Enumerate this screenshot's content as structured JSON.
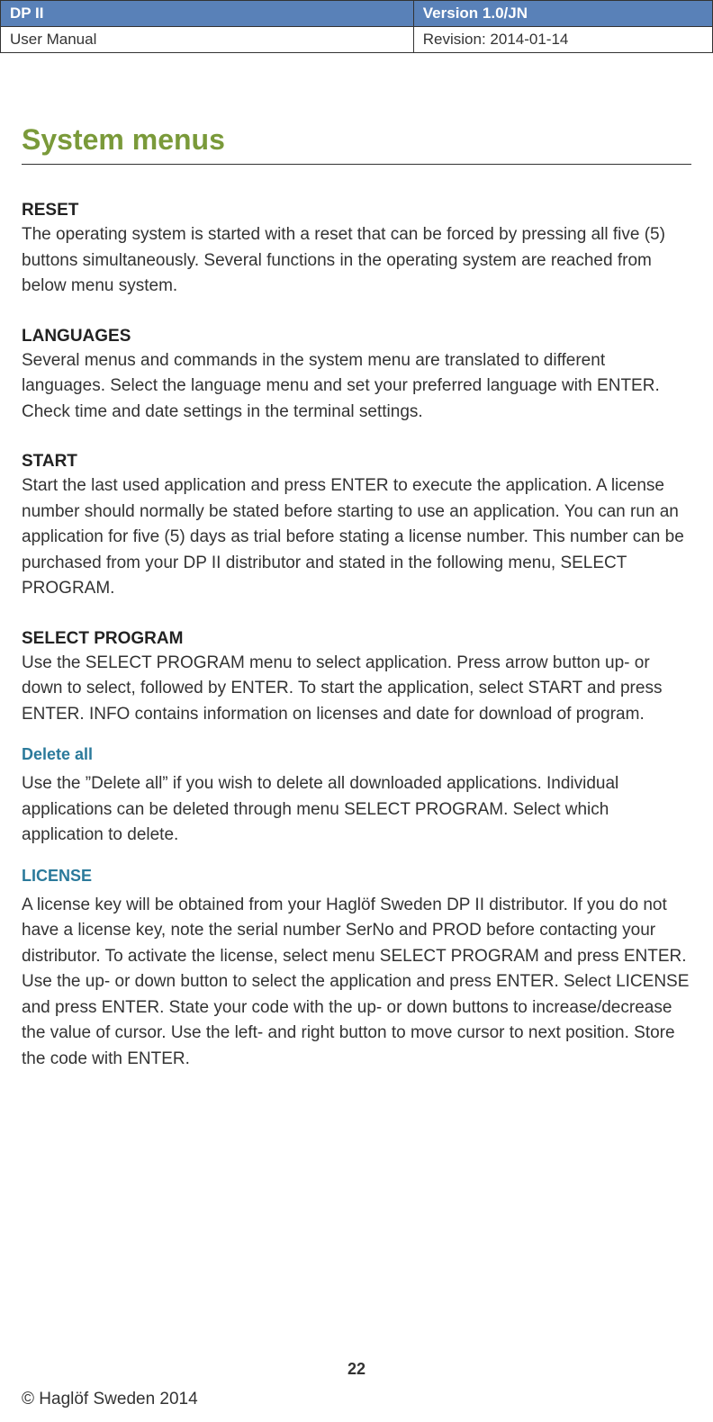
{
  "header": {
    "product": "DP II",
    "version": "Version 1.0/JN",
    "doc_type": "User Manual",
    "revision": "Revision: 2014-01-14"
  },
  "title": "System menus",
  "sections": {
    "reset": {
      "heading": "RESET",
      "text": "The operating system is started with a reset that can be forced by pressing all five (5) buttons simultaneously. Several functions in the operating system are reached from below menu system."
    },
    "languages": {
      "heading": "LANGUAGES",
      "text": "Several menus and commands in the system menu are translated to different languages. Select the language menu and set your preferred language with ENTER. Check time and date settings in the terminal settings."
    },
    "start": {
      "heading": "START",
      "text": "Start the last used application and press ENTER to execute the application. A license number should normally be stated before starting to use an application. You can run an application for five (5) days as trial before stating a license number. This number can be purchased from your DP II distributor and stated in the following menu, SELECT PROGRAM."
    },
    "select_program": {
      "heading": "SELECT PROGRAM",
      "text": "Use the SELECT PROGRAM menu to select application. Press arrow button up- or down to select, followed by ENTER. To start the application, select START and press ENTER. INFO contains information on licenses and date for download of program."
    },
    "delete_all": {
      "heading": "Delete all",
      "text": "Use the ”Delete all” if you wish to delete all downloaded applications. Individual applications can be deleted through menu SELECT PROGRAM. Select which application to delete."
    },
    "license": {
      "heading": "LICENSE",
      "text": "A license key will be obtained from your Haglöf Sweden DP II distributor. If you do not have a license key, note the serial number SerNo and PROD before contacting your distributor. To activate the license, select menu SELECT PROGRAM and press ENTER. Use the up- or down button to select the application and press ENTER. Select LICENSE and press ENTER. State your code with the up- or down buttons to increase/decrease the value of cursor. Use the left- and right button to move cursor to next position. Store the code with ENTER."
    }
  },
  "page_number": "22",
  "footer": "© Haglöf Sweden 2014"
}
